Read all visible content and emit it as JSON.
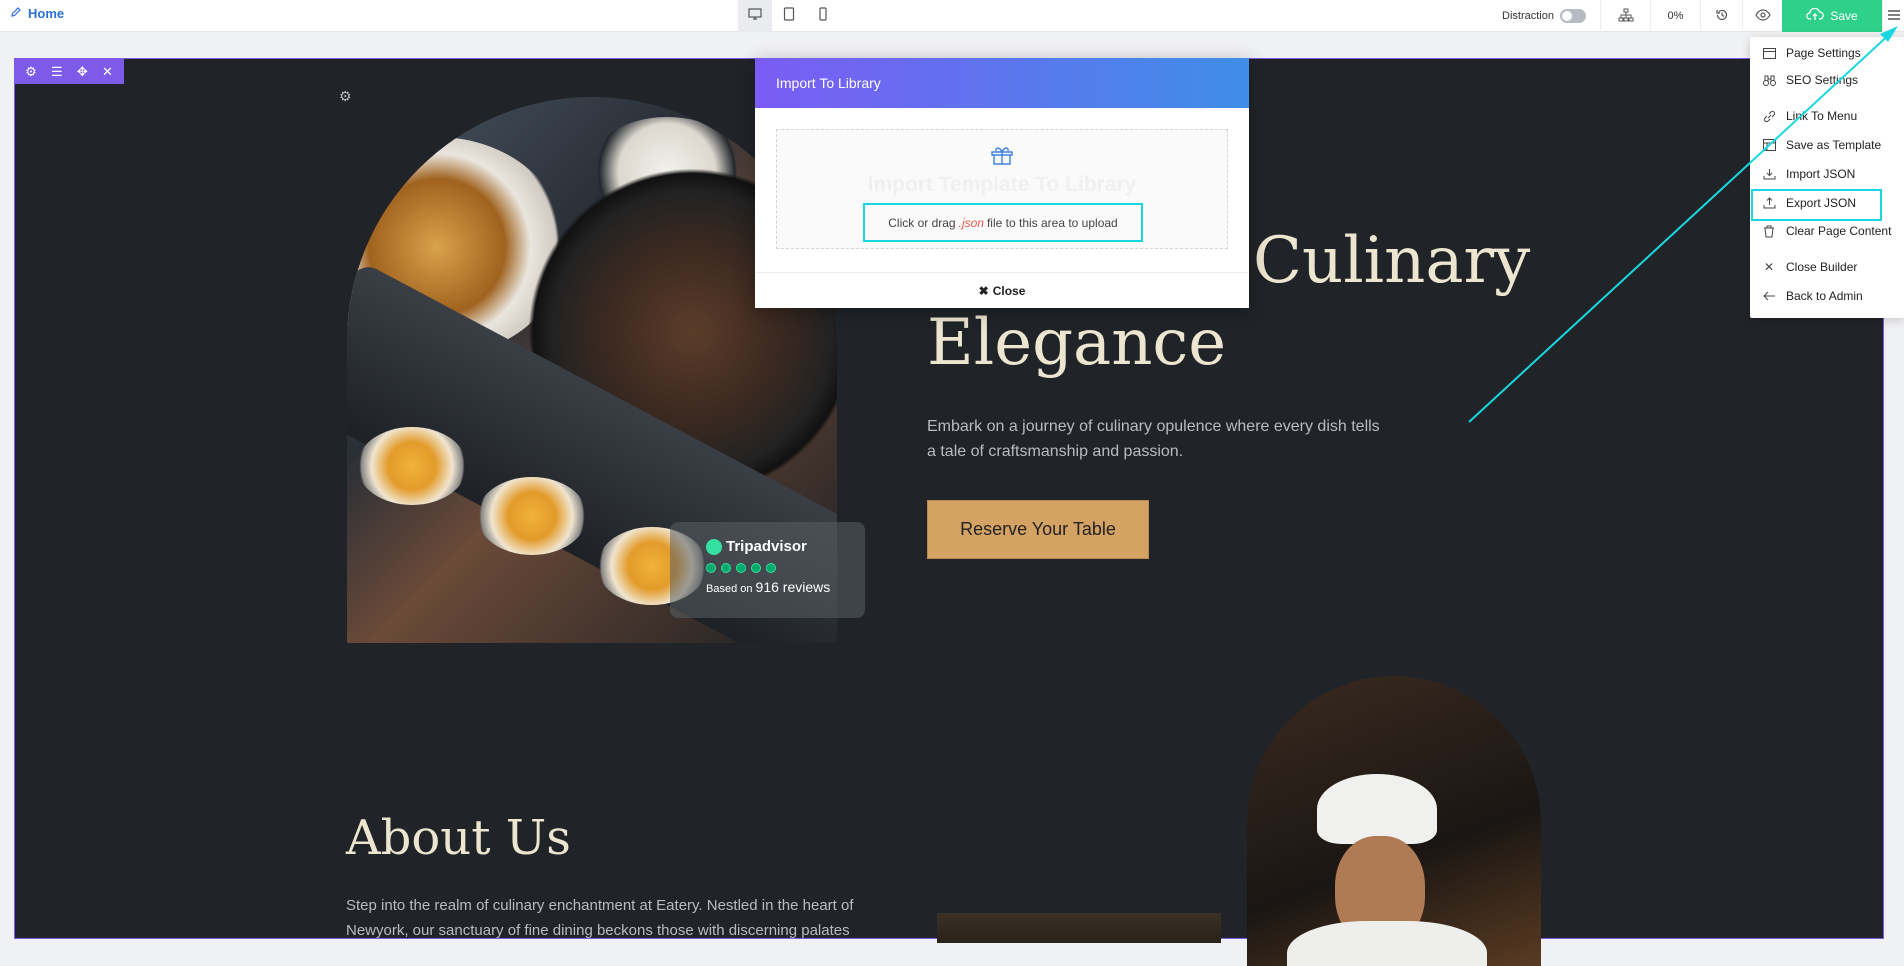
{
  "topbar": {
    "home_label": "Home",
    "devices": [
      "desktop-icon",
      "tablet-icon",
      "mobile-icon"
    ],
    "distraction_label": "Distraction",
    "progress": "0%",
    "save_label": "Save"
  },
  "section_toolbar": {
    "icons": [
      "gear-icon",
      "list-icon",
      "move-icon",
      "close-icon"
    ]
  },
  "hero": {
    "title_line1": "Culinary",
    "title_line2": "Elegance",
    "description": "Embark on a journey of culinary opulence where every dish tells a tale of craftsmanship and passion.",
    "button_label": "Reserve Your Table"
  },
  "tripadvisor": {
    "brand": "Tripadvisor",
    "rating_dots": 5,
    "based_on": "Based on",
    "reviews": "916 reviews"
  },
  "about": {
    "title": "About Us",
    "description": "Step into the realm of culinary enchantment at Eatery. Nestled in the heart of Newyork, our sanctuary of fine dining beckons those with discerning palates"
  },
  "modal": {
    "title": "Import To Library",
    "drop_title": "Import Template To Library",
    "hint_before": "Click or drag",
    "hint_ext": ".json",
    "hint_after": "file to this area to upload",
    "close_label": "Close"
  },
  "menu": {
    "items": [
      {
        "label": "Page Settings",
        "icon": "window-icon"
      },
      {
        "label": "SEO Settings",
        "icon": "binoculars-icon"
      },
      {
        "label": "Link To Menu",
        "icon": "link-icon"
      },
      {
        "label": "Save as Template",
        "icon": "template-icon"
      },
      {
        "label": "Import JSON",
        "icon": "import-icon"
      },
      {
        "label": "Export JSON",
        "icon": "export-icon"
      },
      {
        "label": "Clear Page Content",
        "icon": "trash-icon"
      },
      {
        "label": "Close Builder",
        "icon": "close-icon"
      },
      {
        "label": "Back to Admin",
        "icon": "arrow-left-icon"
      }
    ],
    "highlighted": "Export JSON"
  },
  "colors": {
    "accent": "#7d5ae8",
    "save": "#2fd08a",
    "highlight": "#18d7e0",
    "canvas_bg": "#202428",
    "button_gold": "#d4a262"
  }
}
